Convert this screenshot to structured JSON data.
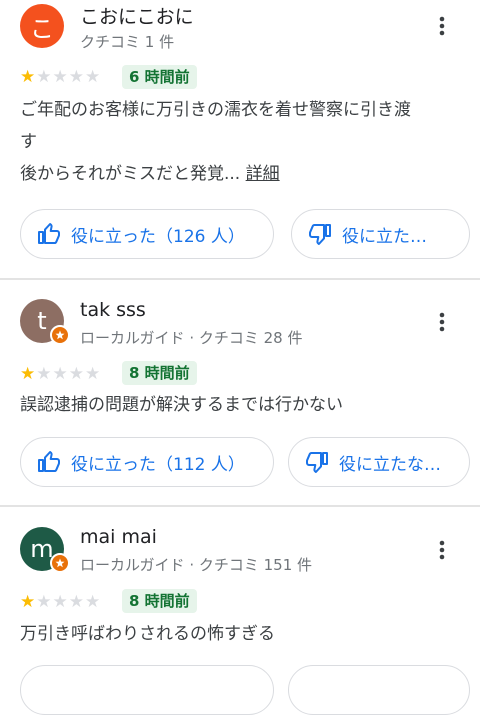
{
  "reviews": [
    {
      "avatar_letter": "こ",
      "avatar_color": "#f4511e",
      "name": "こおにこおに",
      "meta": "クチコミ 1 件",
      "local_guide": false,
      "rating": 1,
      "time": "6 時間前",
      "text_lines": [
        "ご年配のお客様に万引きの濡衣を着せ警察に引き渡",
        "す",
        "後からそれがミスだと発覚..."
      ],
      "more_label": "詳細",
      "helpful_label": "役に立った（126 人）",
      "unhelpful_label": "役に立た…"
    },
    {
      "avatar_letter": "t",
      "avatar_color": "#8d6e63",
      "name": "tak sss",
      "meta": "ローカルガイド · クチコミ 28 件",
      "local_guide": true,
      "rating": 1,
      "time": "8 時間前",
      "text_lines": [
        "誤認逮捕の問題が解決するまでは行かない"
      ],
      "helpful_label": "役に立った（112 人）",
      "unhelpful_label": "役に立たな…"
    },
    {
      "avatar_letter": "m",
      "avatar_color": "#1e5a46",
      "name": "mai mai",
      "meta": "ローカルガイド · クチコミ 151 件",
      "local_guide": true,
      "rating": 1,
      "time": "8 時間前",
      "text_lines": [
        "万引き呼ばわりされるの怖すぎる"
      ]
    }
  ],
  "colors": {
    "accent": "#1a73e8",
    "star_filled": "#fbbc04",
    "star_empty": "#dadce0",
    "time_badge_bg": "#e6f4ea",
    "time_badge_text": "#137333",
    "local_guide_badge": "#e8710a"
  },
  "icons": {
    "more": "more-vert-icon",
    "helpful": "thumb-up-icon",
    "unhelpful": "thumb-down-icon",
    "star": "star-icon",
    "local_guide": "local-guide-badge-icon"
  }
}
